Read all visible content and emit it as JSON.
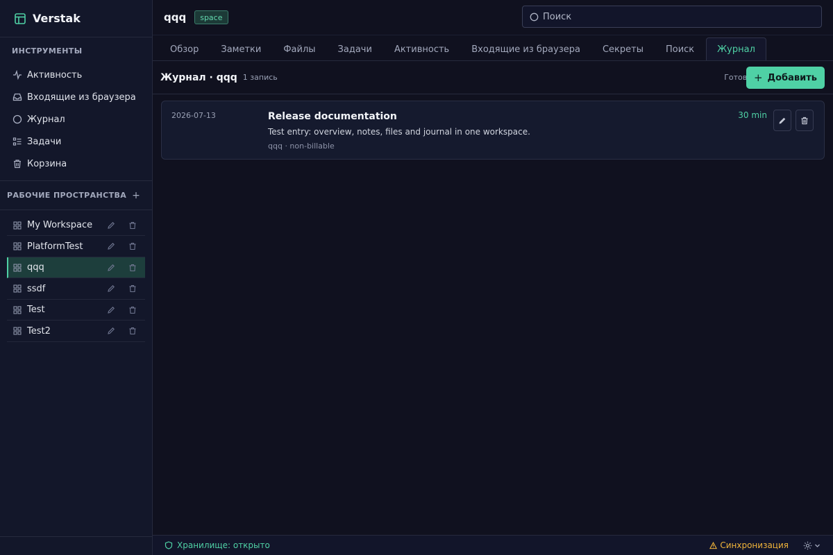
{
  "app": {
    "name": "Verstak"
  },
  "sidebar": {
    "tools_title": "ИНСТРУМЕНТЫ",
    "tools": [
      {
        "label": "Активность",
        "icon": "activity-icon"
      },
      {
        "label": "Входящие из браузера",
        "icon": "inbox-icon"
      },
      {
        "label": "Журнал",
        "icon": "circle-icon"
      },
      {
        "label": "Задачи",
        "icon": "tasks-icon"
      },
      {
        "label": "Корзина",
        "icon": "trash-icon"
      }
    ],
    "workspaces_title": "РАБОЧИЕ ПРОСТРАНСТВА",
    "workspaces_add": "+",
    "workspaces": [
      {
        "name": "My Workspace",
        "active": false
      },
      {
        "name": "PlatformTest",
        "active": false
      },
      {
        "name": "qqq",
        "active": true
      },
      {
        "name": "ssdf",
        "active": false
      },
      {
        "name": "Test",
        "active": false
      },
      {
        "name": "Test2",
        "active": false
      }
    ]
  },
  "header": {
    "title": "qqq",
    "badge": "space",
    "search_placeholder": "Поиск"
  },
  "tabs": [
    {
      "label": "Обзор",
      "active": false
    },
    {
      "label": "Заметки",
      "active": false
    },
    {
      "label": "Файлы",
      "active": false
    },
    {
      "label": "Задачи",
      "active": false
    },
    {
      "label": "Активность",
      "active": false
    },
    {
      "label": "Входящие из браузера",
      "active": false
    },
    {
      "label": "Секреты",
      "active": false
    },
    {
      "label": "Поиск",
      "active": false
    },
    {
      "label": "Журнал",
      "active": true
    }
  ],
  "journal": {
    "title": "Журнал · qqq",
    "count": "1 запись",
    "status": "Готово",
    "add_label": "Добавить",
    "add_plus": "+",
    "entries": [
      {
        "date": "2026-07-13",
        "title": "Release documentation",
        "description": "Test entry: overview, notes, files and journal in one workspace.",
        "meta": "qqq · non-billable",
        "duration": "30 min"
      }
    ]
  },
  "statusbar": {
    "vault": "Хранилище: открыто",
    "sync": "Синхронизация"
  },
  "colors": {
    "accent": "#4fd1a5",
    "background": "#10111f",
    "sidebar": "#13172a",
    "warning": "#f0b43a"
  }
}
